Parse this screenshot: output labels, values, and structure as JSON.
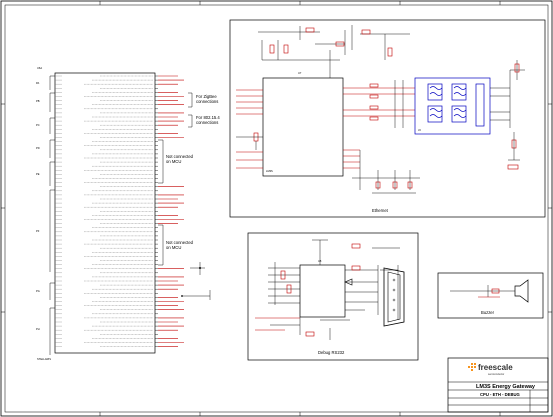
{
  "sheet": {
    "border_ticks_top": [
      "A",
      "B",
      "C",
      "D",
      "E",
      "F"
    ],
    "border_ticks_side": [
      "1",
      "2",
      "3",
      "4"
    ]
  },
  "blocks": {
    "ethernet_label": "Ethernet",
    "debug_label": "Debug RS232",
    "buzzer_label": "Buzzer",
    "zigbee_note": "For ZigBee\nconnections",
    "ieee_note": "For 802.15.4\nconnections",
    "not_connected_1": "Not connected\non MCU",
    "not_connected_2": "Not connected\non MCU"
  },
  "title_block": {
    "company": "freescale",
    "company_sub": "semiconductor",
    "project": "LM3S Energy Gateway",
    "sheet_title": "CPU - ETH - DEBUG"
  },
  "mcu": {
    "left_title": "U6A",
    "bottom_label": "STELLARIS"
  },
  "colors": {
    "wire": "#000000",
    "net": "#c00000",
    "transformer": "#0000c0",
    "logo_orange": "#f7941d"
  }
}
